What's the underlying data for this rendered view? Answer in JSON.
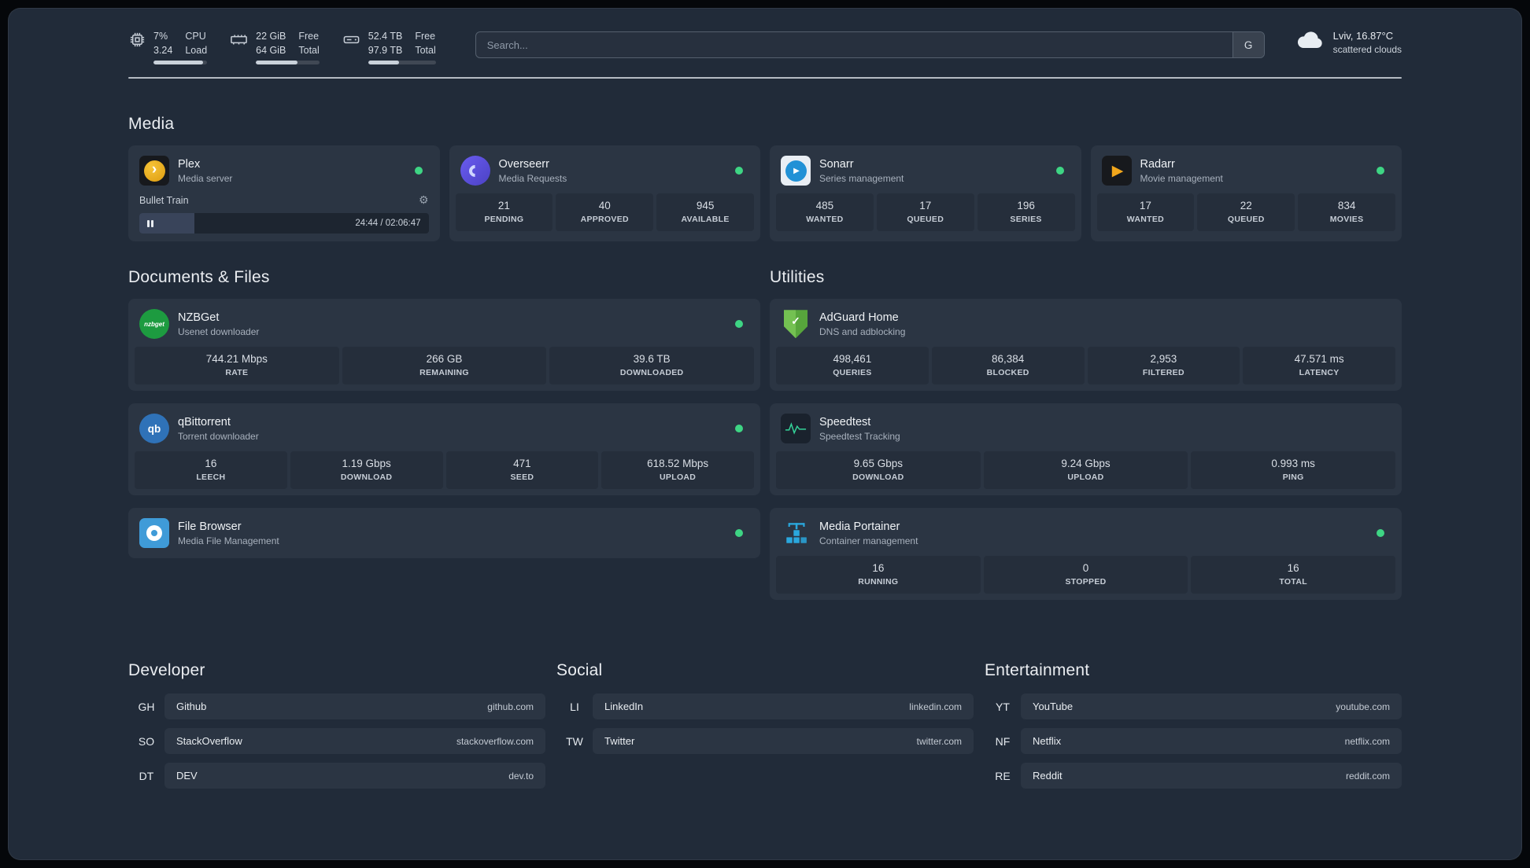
{
  "colors": {
    "background": "#212b39",
    "card": "#2b3543",
    "stat_block": "#252e3b",
    "status_green": "#3ed584",
    "divider": "#cfd5dc",
    "speedtest_wave": "#34d399"
  },
  "icons": {
    "topbar": [
      "cpu-icon",
      "memory-icon",
      "disk-icon",
      "cloud-icon"
    ],
    "services": [
      "plex-icon",
      "overseerr-icon",
      "sonarr-icon",
      "radarr-icon",
      "nzbget-icon",
      "qbittorrent-icon",
      "filebrowser-icon",
      "adguard-shield-icon",
      "speedtest-wave-icon",
      "portainer-crane-icon"
    ],
    "misc": [
      "gear-icon",
      "pause-icon",
      "status-dot"
    ]
  },
  "topbar": {
    "cpu": {
      "value1": "7%",
      "value2": "3.24",
      "label1": "CPU",
      "label2": "Load",
      "bar_style": "width:93%"
    },
    "mem": {
      "value1": "22 GiB",
      "value2": "64 GiB",
      "label1": "Free",
      "label2": "Total",
      "bar_style": "width:66%"
    },
    "disk": {
      "value1": "52.4 TB",
      "value2": "97.9 TB",
      "label1": "Free",
      "label2": "Total",
      "bar_style": "width:46%"
    },
    "search": {
      "placeholder": "Search...",
      "button_label": "G"
    },
    "weather": {
      "location": "Lviv, 16.87°C",
      "condition": "scattered clouds"
    }
  },
  "sections": {
    "media": {
      "title": "Media",
      "cards": [
        {
          "name": "Plex",
          "subtitle": "Media server",
          "player": {
            "track": "Bullet Train",
            "time": "24:44 / 02:06:47",
            "progress_style": "width:19%"
          }
        },
        {
          "name": "Overseerr",
          "subtitle": "Media Requests",
          "stats": [
            {
              "value": "21",
              "label": "PENDING"
            },
            {
              "value": "40",
              "label": "APPROVED"
            },
            {
              "value": "945",
              "label": "AVAILABLE"
            }
          ]
        },
        {
          "name": "Sonarr",
          "subtitle": "Series management",
          "stats": [
            {
              "value": "485",
              "label": "WANTED"
            },
            {
              "value": "17",
              "label": "QUEUED"
            },
            {
              "value": "196",
              "label": "SERIES"
            }
          ]
        },
        {
          "name": "Radarr",
          "subtitle": "Movie management",
          "stats": [
            {
              "value": "17",
              "label": "WANTED"
            },
            {
              "value": "22",
              "label": "QUEUED"
            },
            {
              "value": "834",
              "label": "MOVIES"
            }
          ]
        }
      ]
    },
    "documents": {
      "title": "Documents & Files",
      "cards": [
        {
          "name": "NZBGet",
          "subtitle": "Usenet downloader",
          "stats": [
            {
              "value": "744.21 Mbps",
              "label": "RATE"
            },
            {
              "value": "266 GB",
              "label": "REMAINING"
            },
            {
              "value": "39.6 TB",
              "label": "DOWNLOADED"
            }
          ]
        },
        {
          "name": "qBittorrent",
          "subtitle": "Torrent downloader",
          "stats": [
            {
              "value": "16",
              "label": "LEECH"
            },
            {
              "value": "1.19 Gbps",
              "label": "DOWNLOAD"
            },
            {
              "value": "471",
              "label": "SEED"
            },
            {
              "value": "618.52 Mbps",
              "label": "UPLOAD"
            }
          ]
        },
        {
          "name": "File Browser",
          "subtitle": "Media File Management",
          "stats": []
        }
      ]
    },
    "utilities": {
      "title": "Utilities",
      "cards": [
        {
          "name": "AdGuard Home",
          "subtitle": "DNS and adblocking",
          "stats": [
            {
              "value": "498,461",
              "label": "QUERIES"
            },
            {
              "value": "86,384",
              "label": "BLOCKED"
            },
            {
              "value": "2,953",
              "label": "FILTERED"
            },
            {
              "value": "47.571 ms",
              "label": "LATENCY"
            }
          ]
        },
        {
          "name": "Speedtest",
          "subtitle": "Speedtest Tracking",
          "stats": [
            {
              "value": "9.65 Gbps",
              "label": "DOWNLOAD"
            },
            {
              "value": "9.24 Gbps",
              "label": "UPLOAD"
            },
            {
              "value": "0.993 ms",
              "label": "PING"
            }
          ]
        },
        {
          "name": "Media Portainer",
          "subtitle": "Container management",
          "stats": [
            {
              "value": "16",
              "label": "RUNNING"
            },
            {
              "value": "0",
              "label": "STOPPED"
            },
            {
              "value": "16",
              "label": "TOTAL"
            }
          ]
        }
      ]
    }
  },
  "bookmarks": [
    {
      "title": "Developer",
      "items": [
        {
          "abbr": "GH",
          "name": "Github",
          "url": "github.com"
        },
        {
          "abbr": "SO",
          "name": "StackOverflow",
          "url": "stackoverflow.com"
        },
        {
          "abbr": "DT",
          "name": "DEV",
          "url": "dev.to"
        }
      ]
    },
    {
      "title": "Social",
      "items": [
        {
          "abbr": "LI",
          "name": "LinkedIn",
          "url": "linkedin.com"
        },
        {
          "abbr": "TW",
          "name": "Twitter",
          "url": "twitter.com"
        }
      ]
    },
    {
      "title": "Entertainment",
      "items": [
        {
          "abbr": "YT",
          "name": "YouTube",
          "url": "youtube.com"
        },
        {
          "abbr": "NF",
          "name": "Netflix",
          "url": "netflix.com"
        },
        {
          "abbr": "RE",
          "name": "Reddit",
          "url": "reddit.com"
        }
      ]
    }
  ]
}
